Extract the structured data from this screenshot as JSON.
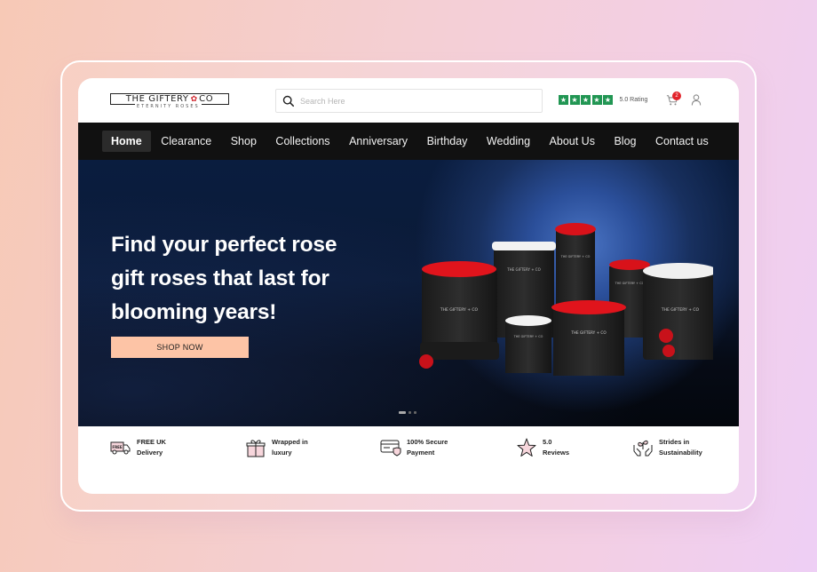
{
  "header": {
    "logo": {
      "name": "THE GIFTERY",
      "amp": "&",
      "suffix": "CO",
      "tagline": "ETERNITY ROSES"
    },
    "search": {
      "placeholder": "Search Here",
      "value": ""
    },
    "rating": {
      "stars": 5,
      "max_stars": 5,
      "label": "5.0 Rating",
      "color": "#219653"
    },
    "cart": {
      "count": "2",
      "badge_color": "#e2232a"
    },
    "icons": {
      "search": "search-icon",
      "cart": "cart-icon",
      "user": "user-icon"
    }
  },
  "nav": {
    "items": [
      {
        "label": "Home",
        "active": true
      },
      {
        "label": "Clearance"
      },
      {
        "label": "Shop"
      },
      {
        "label": "Collections"
      },
      {
        "label": "Anniversary"
      },
      {
        "label": "Birthday"
      },
      {
        "label": "Wedding"
      },
      {
        "label": "About Us"
      },
      {
        "label": "Blog"
      },
      {
        "label": "Contact us"
      }
    ]
  },
  "hero": {
    "title_lines": [
      "Find your perfect rose",
      "gift roses that last for",
      "blooming years!"
    ],
    "cta": "SHOP NOW",
    "cta_color": "#fdc4a6",
    "product_image": "rose-gift-boxes-image",
    "box_brand": "THE GIFTERY + CO",
    "slides": {
      "count": 3,
      "active": 1
    }
  },
  "features": [
    {
      "icon": "delivery-truck-icon",
      "line1": "FREE UK",
      "line2": "Delivery"
    },
    {
      "icon": "gift-icon",
      "line1": "Wrapped in",
      "line2": "luxury"
    },
    {
      "icon": "secure-card-icon",
      "line1": "100% Secure",
      "line2": "Payment"
    },
    {
      "icon": "star-icon",
      "line1": "5.0",
      "line2": "Reviews"
    },
    {
      "icon": "sustainability-hands-icon",
      "line1": "Strides in",
      "line2": "Sustainability"
    }
  ]
}
